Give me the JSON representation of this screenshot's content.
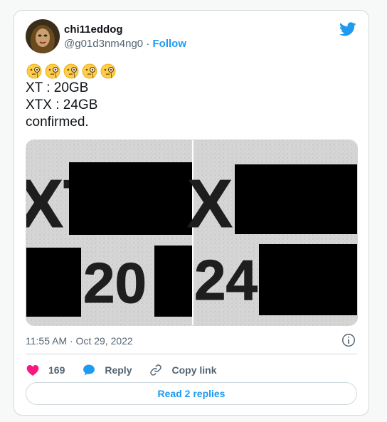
{
  "author": {
    "display_name": "chi11eddog",
    "handle": "@g01d3nm4ng0",
    "separator": "·",
    "follow_label": "Follow"
  },
  "tweet": {
    "emojis": [
      "monocle-face",
      "monocle-face",
      "monocle-face",
      "monocle-face",
      "monocle-face"
    ],
    "lines": [
      "XT : 20GB",
      "XTX : 24GB",
      "confirmed."
    ],
    "media": {
      "left_panel_text": [
        "XT",
        "20"
      ],
      "right_panel_text": [
        "X",
        "24"
      ]
    },
    "timestamp": "11:55 AM · Oct 29, 2022"
  },
  "actions": {
    "likes_count": "169",
    "reply_label": "Reply",
    "copy_link_label": "Copy link"
  },
  "read_replies_label": "Read 2 replies",
  "colors": {
    "accent": "#1d9bf0",
    "like": "#f91880",
    "border": "#cfd9de",
    "secondary_text": "#536471"
  },
  "icons": [
    "twitter-bird-icon",
    "info-icon",
    "heart-icon",
    "reply-bubble-icon",
    "link-icon"
  ]
}
